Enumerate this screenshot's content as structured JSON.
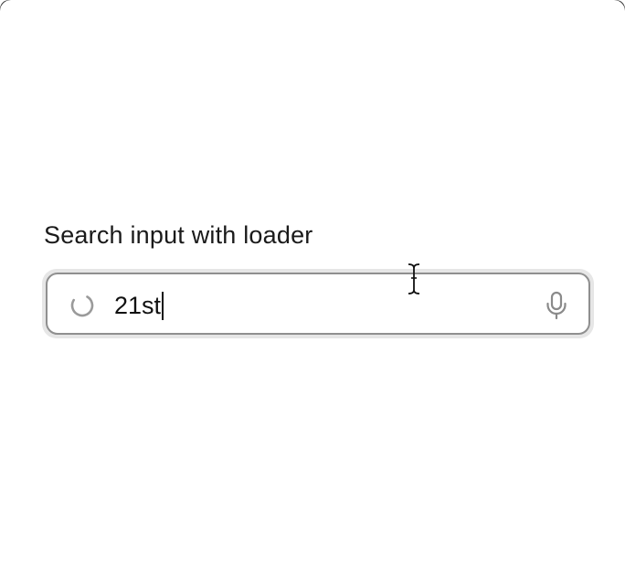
{
  "section": {
    "title": "Search input with loader"
  },
  "search": {
    "value": "21st",
    "loading": true
  },
  "icons": {
    "loader": "loader-spinner-icon",
    "mic": "microphone-icon",
    "pointer": "text-cursor-icon"
  },
  "colors": {
    "text": "#111111",
    "border": "#8f8f8f",
    "ring": "#e6e6e6",
    "icon": "#8a8a8a"
  }
}
